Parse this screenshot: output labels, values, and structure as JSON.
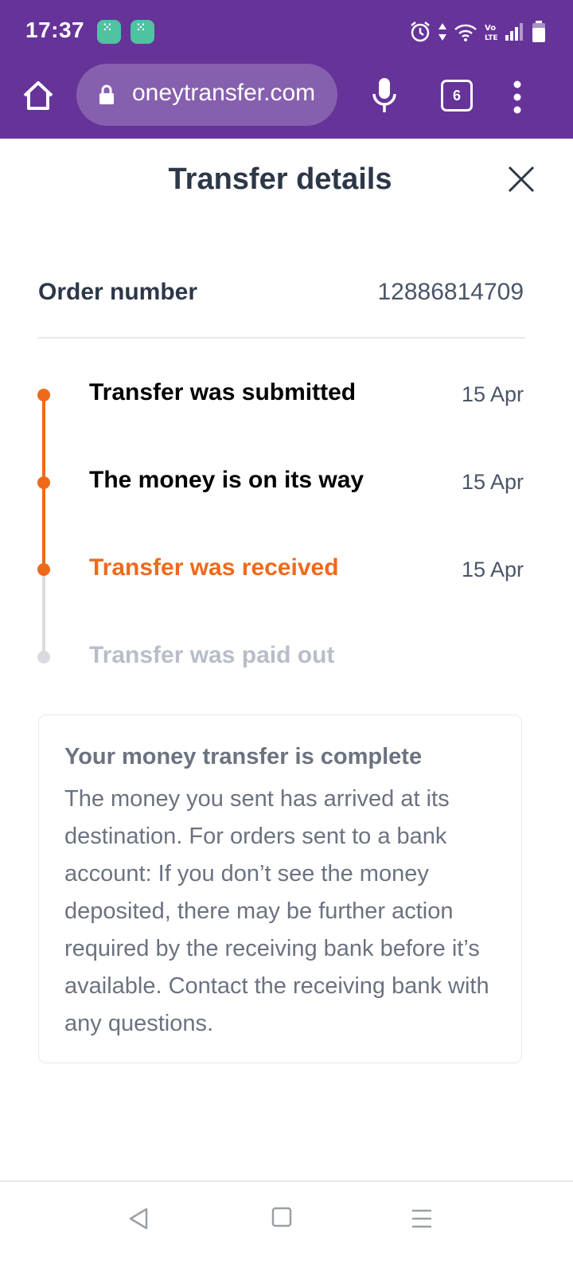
{
  "status_bar": {
    "time": "17:37",
    "icons": [
      "app-notification-icon",
      "app-notification-icon",
      "alarm-icon",
      "data-arrows-icon",
      "wifi-icon",
      "volte-icon",
      "signal-icon",
      "battery-icon"
    ]
  },
  "browser": {
    "url": "oneytransfer.com",
    "tab_count": "6",
    "icons": [
      "home-icon",
      "lock-icon",
      "mic-icon",
      "tabs-icon",
      "more-vertical-icon"
    ]
  },
  "page": {
    "title": "Transfer details",
    "order_label": "Order number",
    "order_number": "12886814709"
  },
  "timeline": {
    "steps": [
      {
        "label": "Transfer was submitted",
        "date": "15 Apr",
        "state": "done"
      },
      {
        "label": "The money is on its way",
        "date": "15 Apr",
        "state": "done"
      },
      {
        "label": "Transfer was received",
        "date": "15 Apr",
        "state": "current"
      },
      {
        "label": "Transfer was paid out",
        "date": "",
        "state": "pending"
      }
    ]
  },
  "notice": {
    "title": "Your money transfer is complete",
    "body": "The money you sent has arrived at its destination. For orders sent to a bank account: If you don’t see the money deposited, there may be further action required by the receiving bank before it’s available. Contact the receiving bank with any questions."
  },
  "colors": {
    "brand_purple": "#663399",
    "accent_orange": "#ee6a1a",
    "heading": "#2d3748",
    "muted": "#6b7280",
    "pending": "#b8bec8"
  }
}
